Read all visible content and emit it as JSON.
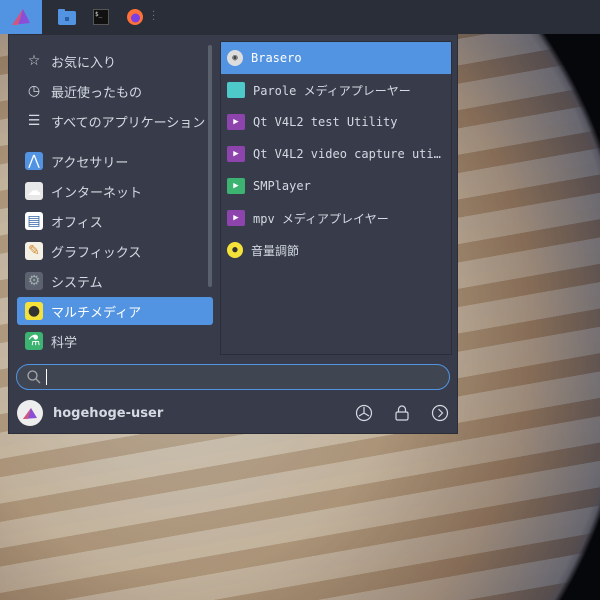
{
  "taskbar": {
    "items": [
      "whisker-menu",
      "file-manager",
      "terminal",
      "firefox"
    ],
    "terminal_glyph": "$_"
  },
  "categories": [
    {
      "label": "お気に入り",
      "icon": "star-icon"
    },
    {
      "label": "最近使ったもの",
      "icon": "clock-icon"
    },
    {
      "label": "すべてのアプリケーション",
      "icon": "list-icon"
    },
    {
      "label": "アクセサリー",
      "icon": "accessories-icon"
    },
    {
      "label": "インターネット",
      "icon": "cloud-icon"
    },
    {
      "label": "オフィス",
      "icon": "office-icon"
    },
    {
      "label": "グラフィックス",
      "icon": "graphics-icon"
    },
    {
      "label": "システム",
      "icon": "system-icon"
    },
    {
      "label": "マルチメディア",
      "icon": "multimedia-icon",
      "selected": true
    },
    {
      "label": "科学",
      "icon": "science-icon"
    }
  ],
  "apps": [
    {
      "label": "Brasero",
      "icon": "disc-icon",
      "selected": true
    },
    {
      "label": "Parole メディアプレーヤー",
      "icon": "clapper-icon"
    },
    {
      "label": "Qt V4L2 test Utility",
      "icon": "video-icon"
    },
    {
      "label": "Qt V4L2 video capture uti…",
      "icon": "video-icon"
    },
    {
      "label": "SMPlayer",
      "icon": "play-icon"
    },
    {
      "label": "mpv メディアプレイヤー",
      "icon": "video-icon"
    },
    {
      "label": "音量調節",
      "icon": "volume-icon"
    }
  ],
  "search": {
    "value": "",
    "placeholder": ""
  },
  "user": {
    "name": "hogehoge-user"
  },
  "colors": {
    "accent": "#5294e2",
    "menu_bg": "#383c4a",
    "panel_bg": "#2a2e39"
  }
}
